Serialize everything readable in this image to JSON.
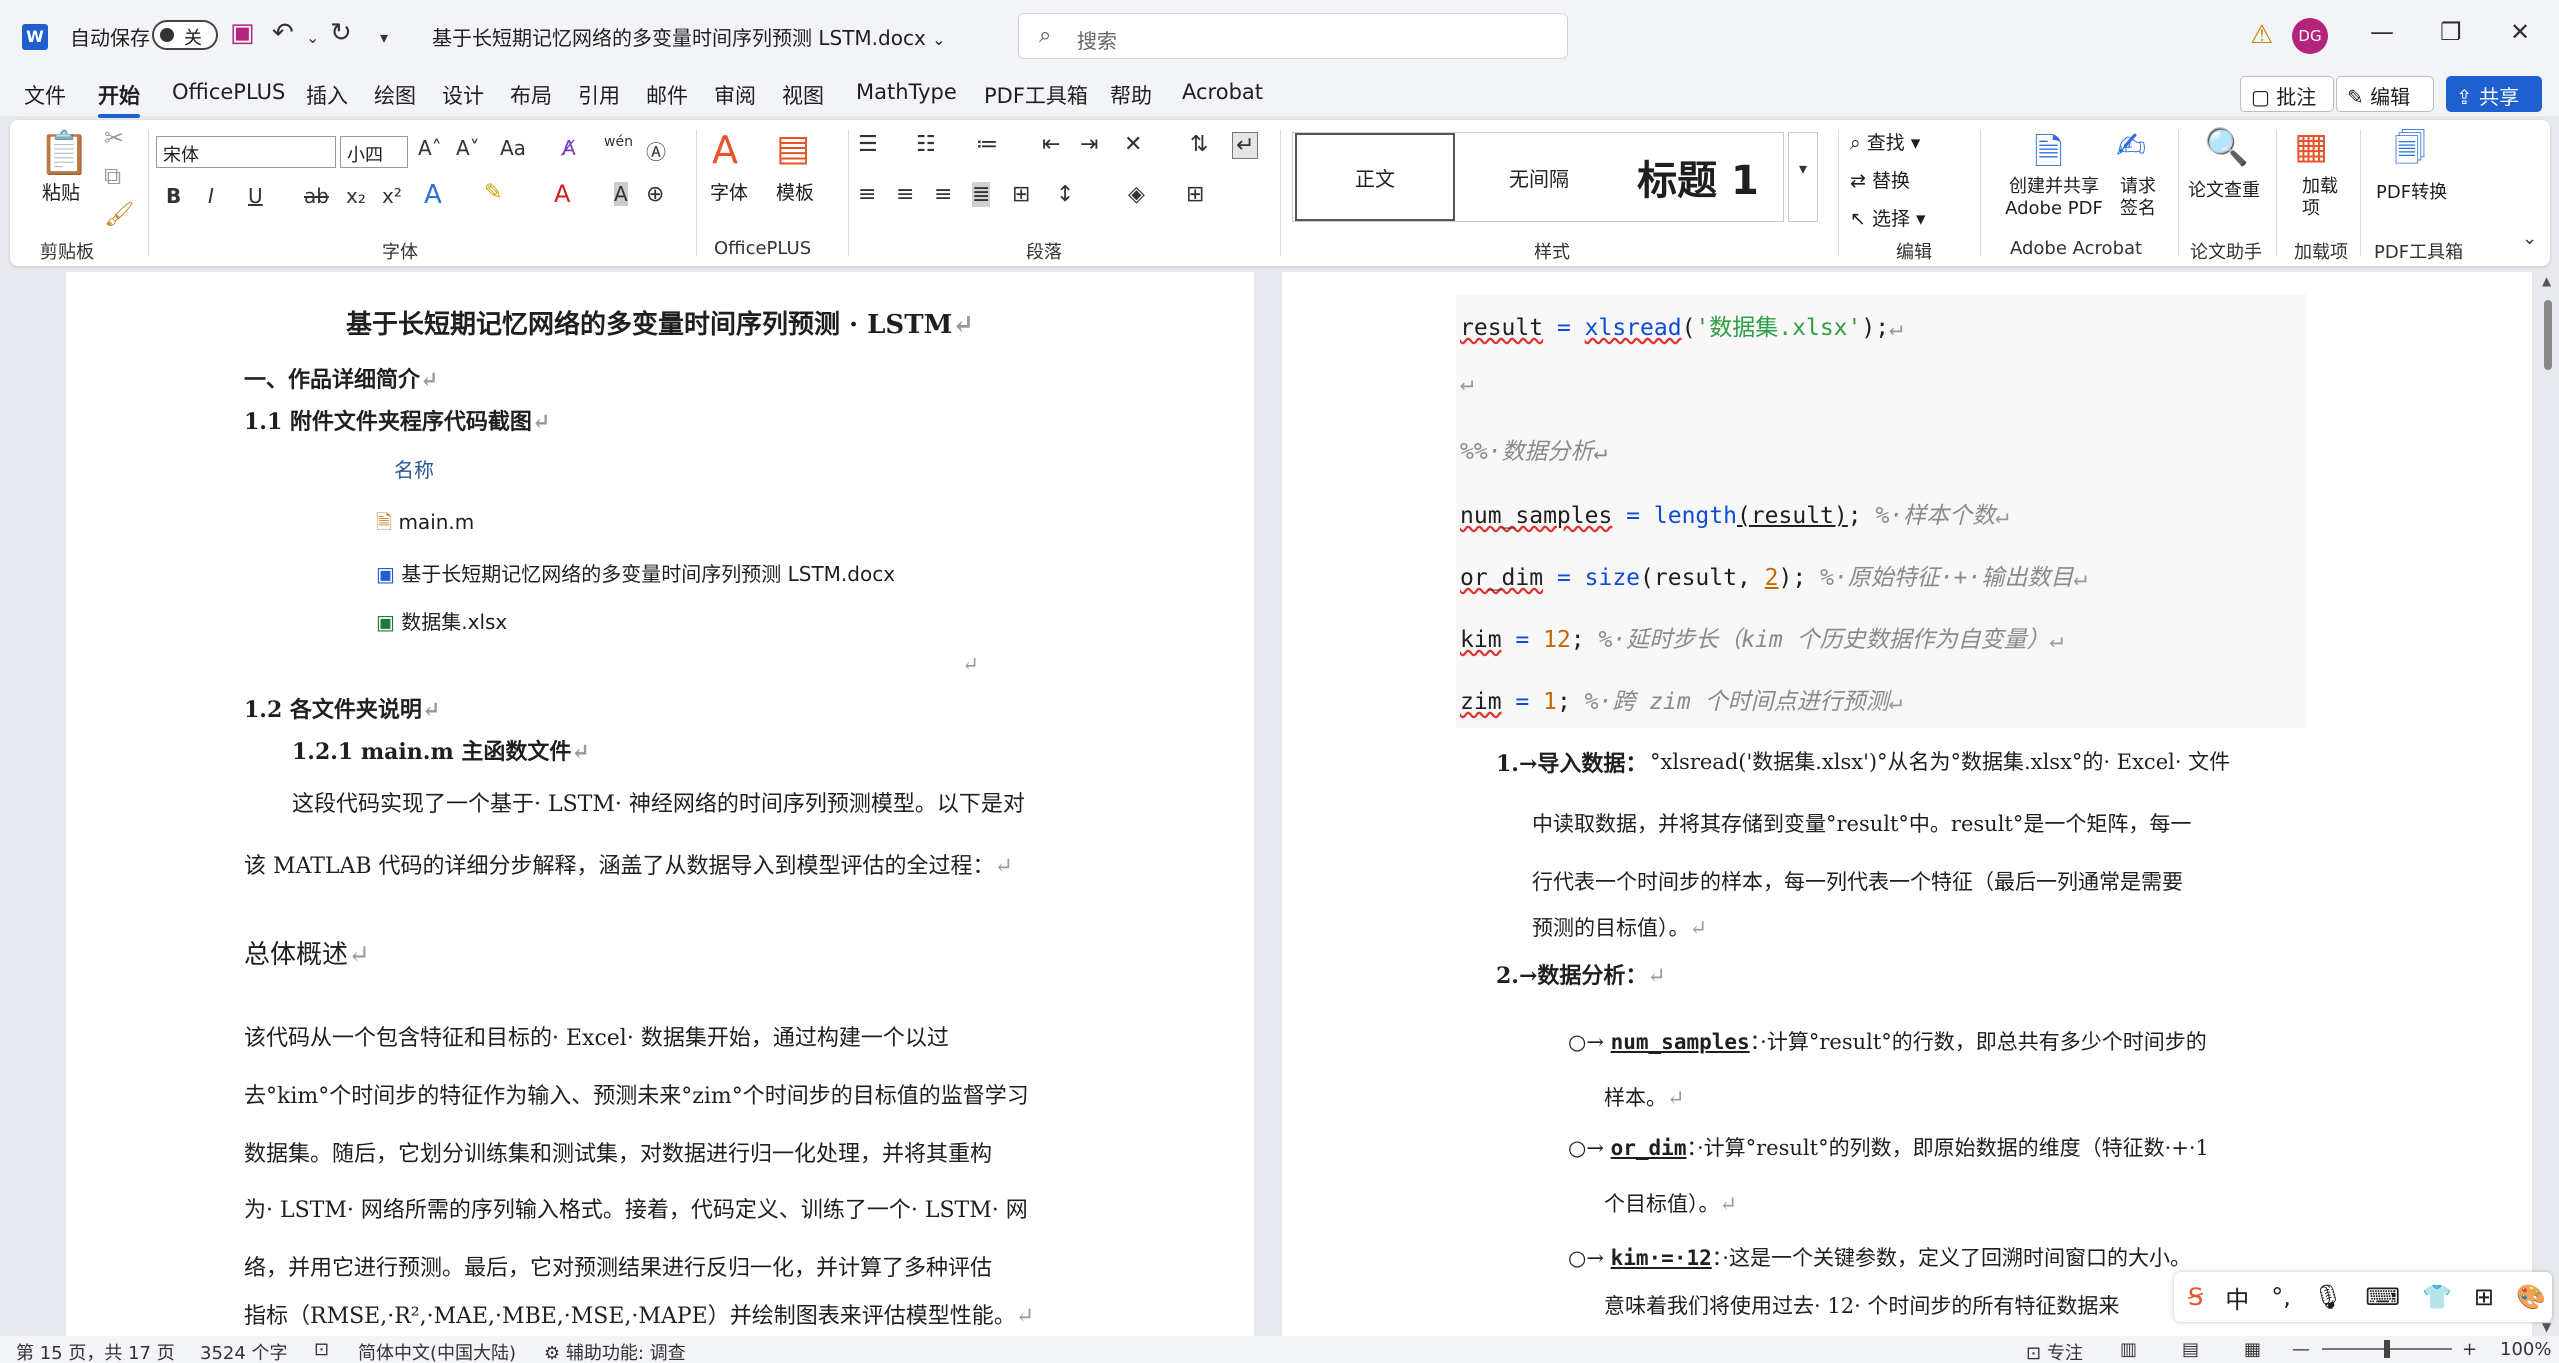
{
  "titlebar": {
    "app_logo": "W",
    "autosave_label": "自动保存",
    "autosave_state": "关",
    "doc_title": "基于长短期记忆网络的多变量时间序列预测 LSTM.docx",
    "search_placeholder": "搜索",
    "user_initials": "DG"
  },
  "menu": {
    "tabs": [
      "文件",
      "开始",
      "OfficePLUS",
      "插入",
      "绘图",
      "设计",
      "布局",
      "引用",
      "邮件",
      "审阅",
      "视图",
      "MathType",
      "PDF工具箱",
      "帮助",
      "Acrobat"
    ],
    "active": "开始",
    "comment_label": "批注",
    "edit_label": "编辑",
    "share_label": "共享"
  },
  "ribbon": {
    "groups": [
      "剪贴板",
      "字体",
      "OfficePLUS",
      "段落",
      "样式",
      "编辑",
      "Adobe Acrobat",
      "论文助手",
      "加载项",
      "PDF工具箱"
    ],
    "paste_label": "粘贴",
    "font_name": "宋体",
    "font_size": "小四",
    "fontstyle_label": "字体",
    "template_label": "模板",
    "styles": [
      "正文",
      "无间隔",
      "标题 1"
    ],
    "find_label": "查找",
    "replace_label": "替换",
    "select_label": "选择",
    "create_pdf_label": "创建并共享 Adobe PDF",
    "request_sign_label": "请求签名",
    "paper_check_label": "论文查重",
    "addin_label": "加载项",
    "pdf_convert_label": "PDF转换"
  },
  "left_page": {
    "title": "基于长短期记忆网络的多变量时间序列预测 · LSTM",
    "h1": "一、作品详细简介",
    "h11": "1.1 附件文件夹程序代码截图",
    "files_header": "名称",
    "files": [
      "main.m",
      "基于长短期记忆网络的多变量时间序列预测 LSTM.docx",
      "数据集.xlsx"
    ],
    "h12": "1.2 各文件夹说明",
    "h121": "1.2.1 main.m 主函数文件",
    "p1a": "这段代码实现了一个基于· LSTM· 神经网络的时间序列预测模型。以下是对",
    "p1b": "该 MATLAB 代码的详细分步解释，涵盖了从数据导入到模型评估的全过程：",
    "h_overview": "总体概述",
    "p2": [
      "该代码从一个包含特征和目标的· Excel· 数据集开始，通过构建一个以过",
      "去°kim°个时间步的特征作为输入、预测未来°zim°个时间步的目标值的监督学习",
      "数据集。随后，它划分训练集和测试集，对数据进行归一化处理，并将其重构",
      "为· LSTM· 网络所需的序列输入格式。接着，代码定义、训练了一个· LSTM· 网",
      "络，并用它进行预测。最后，它对预测结果进行反归一化，并计算了多种评估",
      "指标（RMSE,·R²,·MAE,·MBE,·MSE,·MAPE）并绘制图表来评估模型性能。"
    ]
  },
  "right_page": {
    "code": {
      "l1": [
        "result",
        " = ",
        "xlsread",
        "(",
        "'数据集.xlsx'",
        ");"
      ],
      "l3": "%%·数据分析",
      "l4": [
        "num_samples",
        " = ",
        "length",
        "(result)",
        ";",
        "%·样本个数"
      ],
      "l5": [
        "or_dim",
        " = ",
        "size",
        "(result,",
        "2",
        ");",
        "%·原始特征·+·输出数目"
      ],
      "l6": [
        "kim",
        " = ",
        "12",
        ";",
        "%·延时步长（kim 个历史数据作为自变量）"
      ],
      "l7": [
        "zim",
        " = ",
        "1",
        ";",
        "%·跨 zim 个时间点进行预测"
      ]
    },
    "item1_label": "1.→导入数据：",
    "item1_lines": [
      "°xlsread('数据集.xlsx')°从名为°数据集.xlsx°的· Excel· 文件",
      "中读取数据，并将其存储到变量°result°中。result°是一个矩阵，每一",
      "行代表一个时间步的样本，每一列代表一个特征（最后一列通常是需要",
      "预测的目标值）。"
    ],
    "item2_label": "2.→数据分析：",
    "bullets": [
      {
        "key": "num_samples",
        "text": "：·计算°result°的行数，即总共有多少个时间步的",
        "cont": "样本。"
      },
      {
        "key": "or_dim",
        "text": "：·计算°result°的列数，即原始数据的维度（特征数·+·1",
        "cont": "个目标值）。"
      },
      {
        "key": "kim·=·12",
        "text": "：·这是一个关键参数，定义了回溯时间窗口的大小。",
        "cont": "意味着我们将使用过去· 12· 个时间步的所有特征数据来"
      }
    ]
  },
  "status": {
    "page": "第 15 页，共 17 页",
    "words": "3524 个字",
    "lang": "简体中文(中国大陆)",
    "accessibility": "辅助功能: 调查",
    "focus": "专注",
    "zoom": "100%"
  },
  "ime": {
    "lang": "中"
  },
  "colors": {
    "accent": "#1f5fd0",
    "avatar": "#b4237c"
  }
}
